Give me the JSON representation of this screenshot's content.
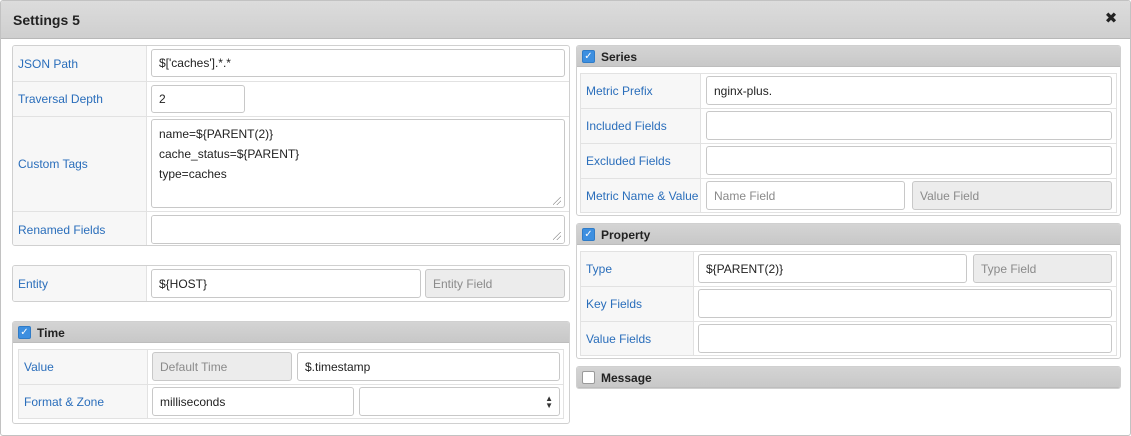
{
  "dialog": {
    "title": "Settings 5",
    "close_icon": "✖"
  },
  "left": {
    "json_path": {
      "label": "JSON Path",
      "value": "$['caches'].*.*"
    },
    "traversal_depth": {
      "label": "Traversal Depth",
      "value": "2"
    },
    "custom_tags": {
      "label": "Custom Tags",
      "value": "name=${PARENT(2)}\ncache_status=${PARENT}\ntype=caches"
    },
    "renamed_fields": {
      "label": "Renamed Fields",
      "value": ""
    },
    "entity": {
      "label": "Entity",
      "value": "${HOST}",
      "field_placeholder": "Entity Field"
    },
    "time": {
      "title": "Time",
      "checked": true,
      "value": {
        "label": "Value",
        "default_placeholder": "Default Time",
        "value": "$.timestamp"
      },
      "format_zone": {
        "label": "Format & Zone",
        "format": "milliseconds",
        "zone": ""
      }
    }
  },
  "right": {
    "series": {
      "title": "Series",
      "checked": true,
      "metric_prefix": {
        "label": "Metric Prefix",
        "value": "nginx-plus."
      },
      "included_fields": {
        "label": "Included Fields",
        "value": ""
      },
      "excluded_fields": {
        "label": "Excluded Fields",
        "value": ""
      },
      "metric_name_value": {
        "label": "Metric Name & Value",
        "name_placeholder": "Name Field",
        "value_placeholder": "Value Field"
      }
    },
    "property": {
      "title": "Property",
      "checked": true,
      "type": {
        "label": "Type",
        "value": "${PARENT(2)}",
        "field_placeholder": "Type Field"
      },
      "key_fields": {
        "label": "Key Fields",
        "value": ""
      },
      "value_fields": {
        "label": "Value Fields",
        "value": ""
      }
    },
    "message": {
      "title": "Message",
      "checked": false
    }
  }
}
